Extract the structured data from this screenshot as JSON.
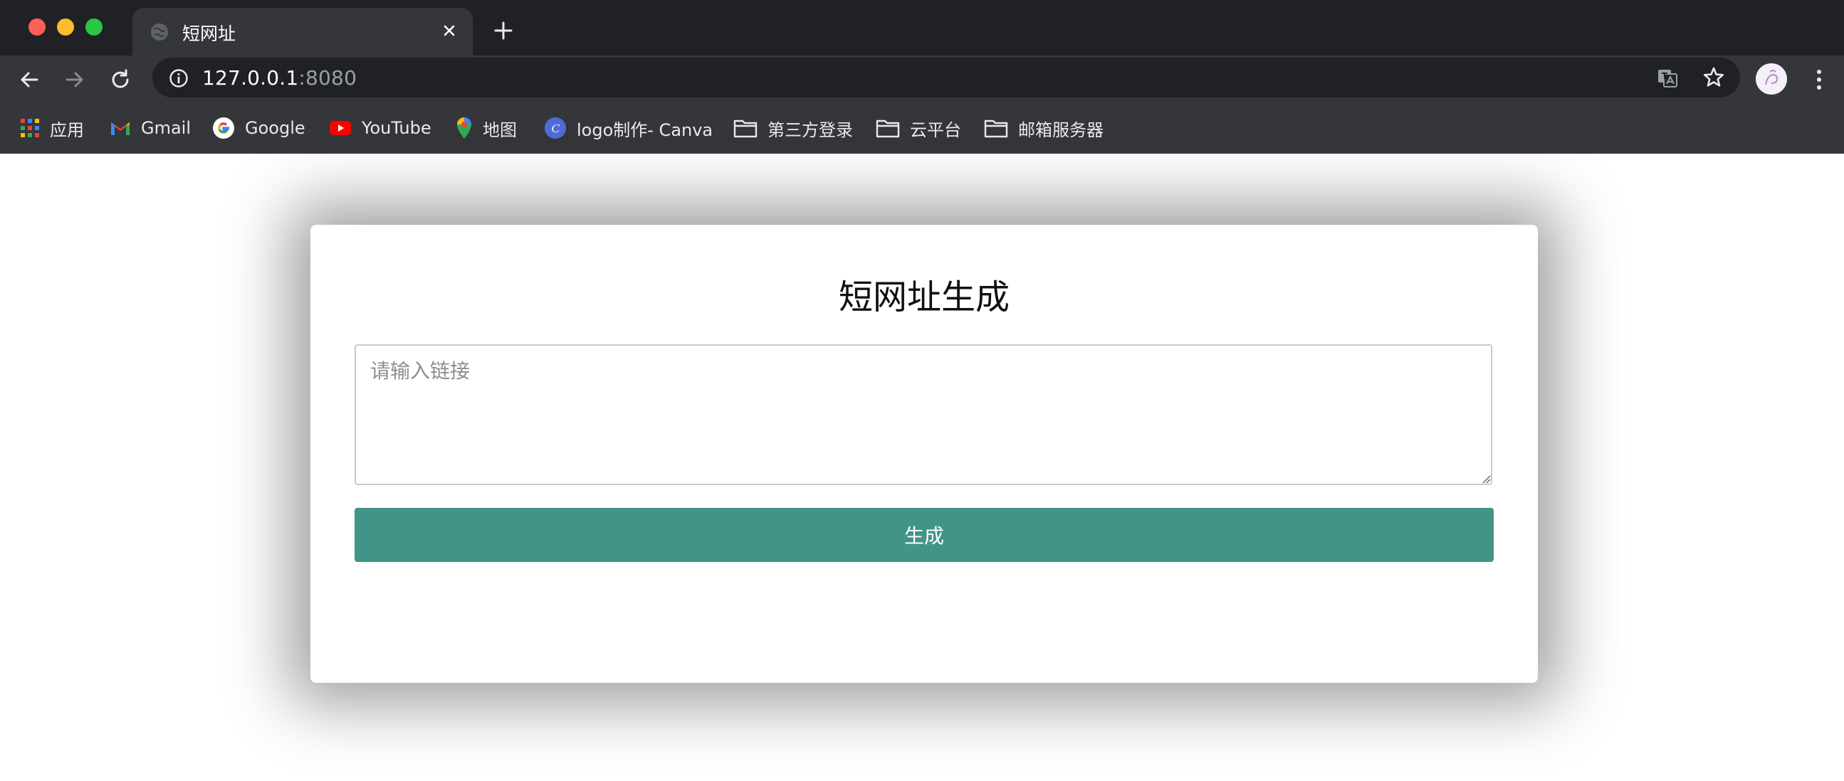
{
  "browser": {
    "tab": {
      "title": "短网址"
    },
    "address": {
      "host": "127.0.0.1",
      "port": ":8080"
    },
    "bookmarks": [
      {
        "label": "应用",
        "icon": "apps-grid-icon"
      },
      {
        "label": "Gmail",
        "icon": "gmail-icon"
      },
      {
        "label": "Google",
        "icon": "google-icon"
      },
      {
        "label": "YouTube",
        "icon": "youtube-icon"
      },
      {
        "label": "地图",
        "icon": "maps-pin-icon"
      },
      {
        "label": "logo制作- Canva",
        "icon": "canva-icon"
      },
      {
        "label": "第三方登录",
        "icon": "folder-icon"
      },
      {
        "label": "云平台",
        "icon": "folder-icon"
      },
      {
        "label": "邮箱服务器",
        "icon": "folder-icon"
      }
    ]
  },
  "form": {
    "title": "短网址生成",
    "input_placeholder": "请输入链接",
    "input_value": "",
    "submit_label": "生成"
  },
  "colors": {
    "button": "#429488",
    "chrome_bg": "#35363a",
    "titlebar_bg": "#202124"
  }
}
